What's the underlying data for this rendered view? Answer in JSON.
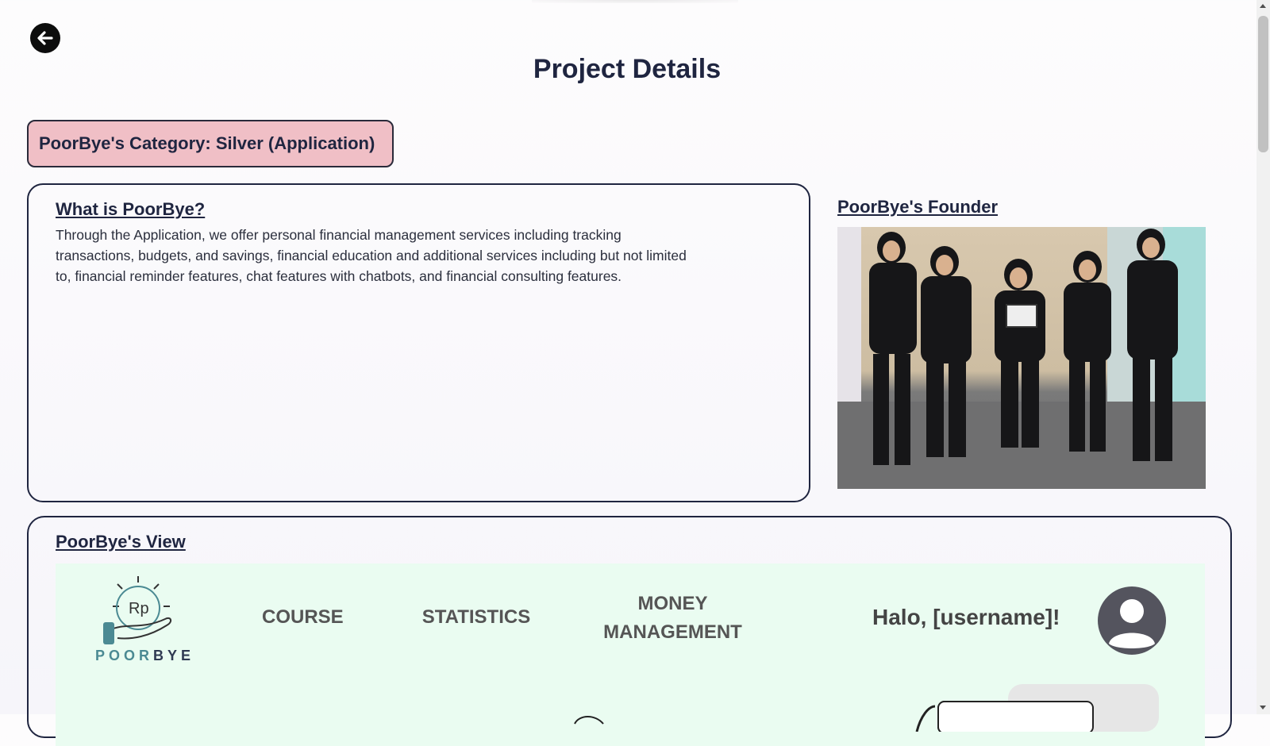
{
  "header": {
    "title": "Project Details"
  },
  "category": {
    "label": "PoorBye's Category: Silver (Application)"
  },
  "about": {
    "heading": "What is PoorBye?",
    "text": "Through the Application, we offer personal financial management services including tracking transactions, budgets, and savings, financial education and additional services including but not limited to, financial reminder features, chat features with chatbots, and financial consulting features."
  },
  "founder": {
    "heading": "PoorBye's Founder"
  },
  "view": {
    "heading": "PoorBye's View",
    "preview": {
      "logo_text_left": "POOR",
      "logo_text_right": "BYE",
      "logo_symbol": "Rp",
      "nav": [
        "COURSE",
        "STATISTICS",
        "MONEY MANAGEMENT"
      ],
      "greeting": "Halo, [username]!",
      "background_color": "#eafcf1"
    }
  },
  "colors": {
    "heading": "#1f2540",
    "category_badge": "#f0bfc6",
    "logo_teal": "#4b8a93"
  },
  "icons": {
    "back": "arrow-left-icon",
    "avatar": "user-icon"
  }
}
